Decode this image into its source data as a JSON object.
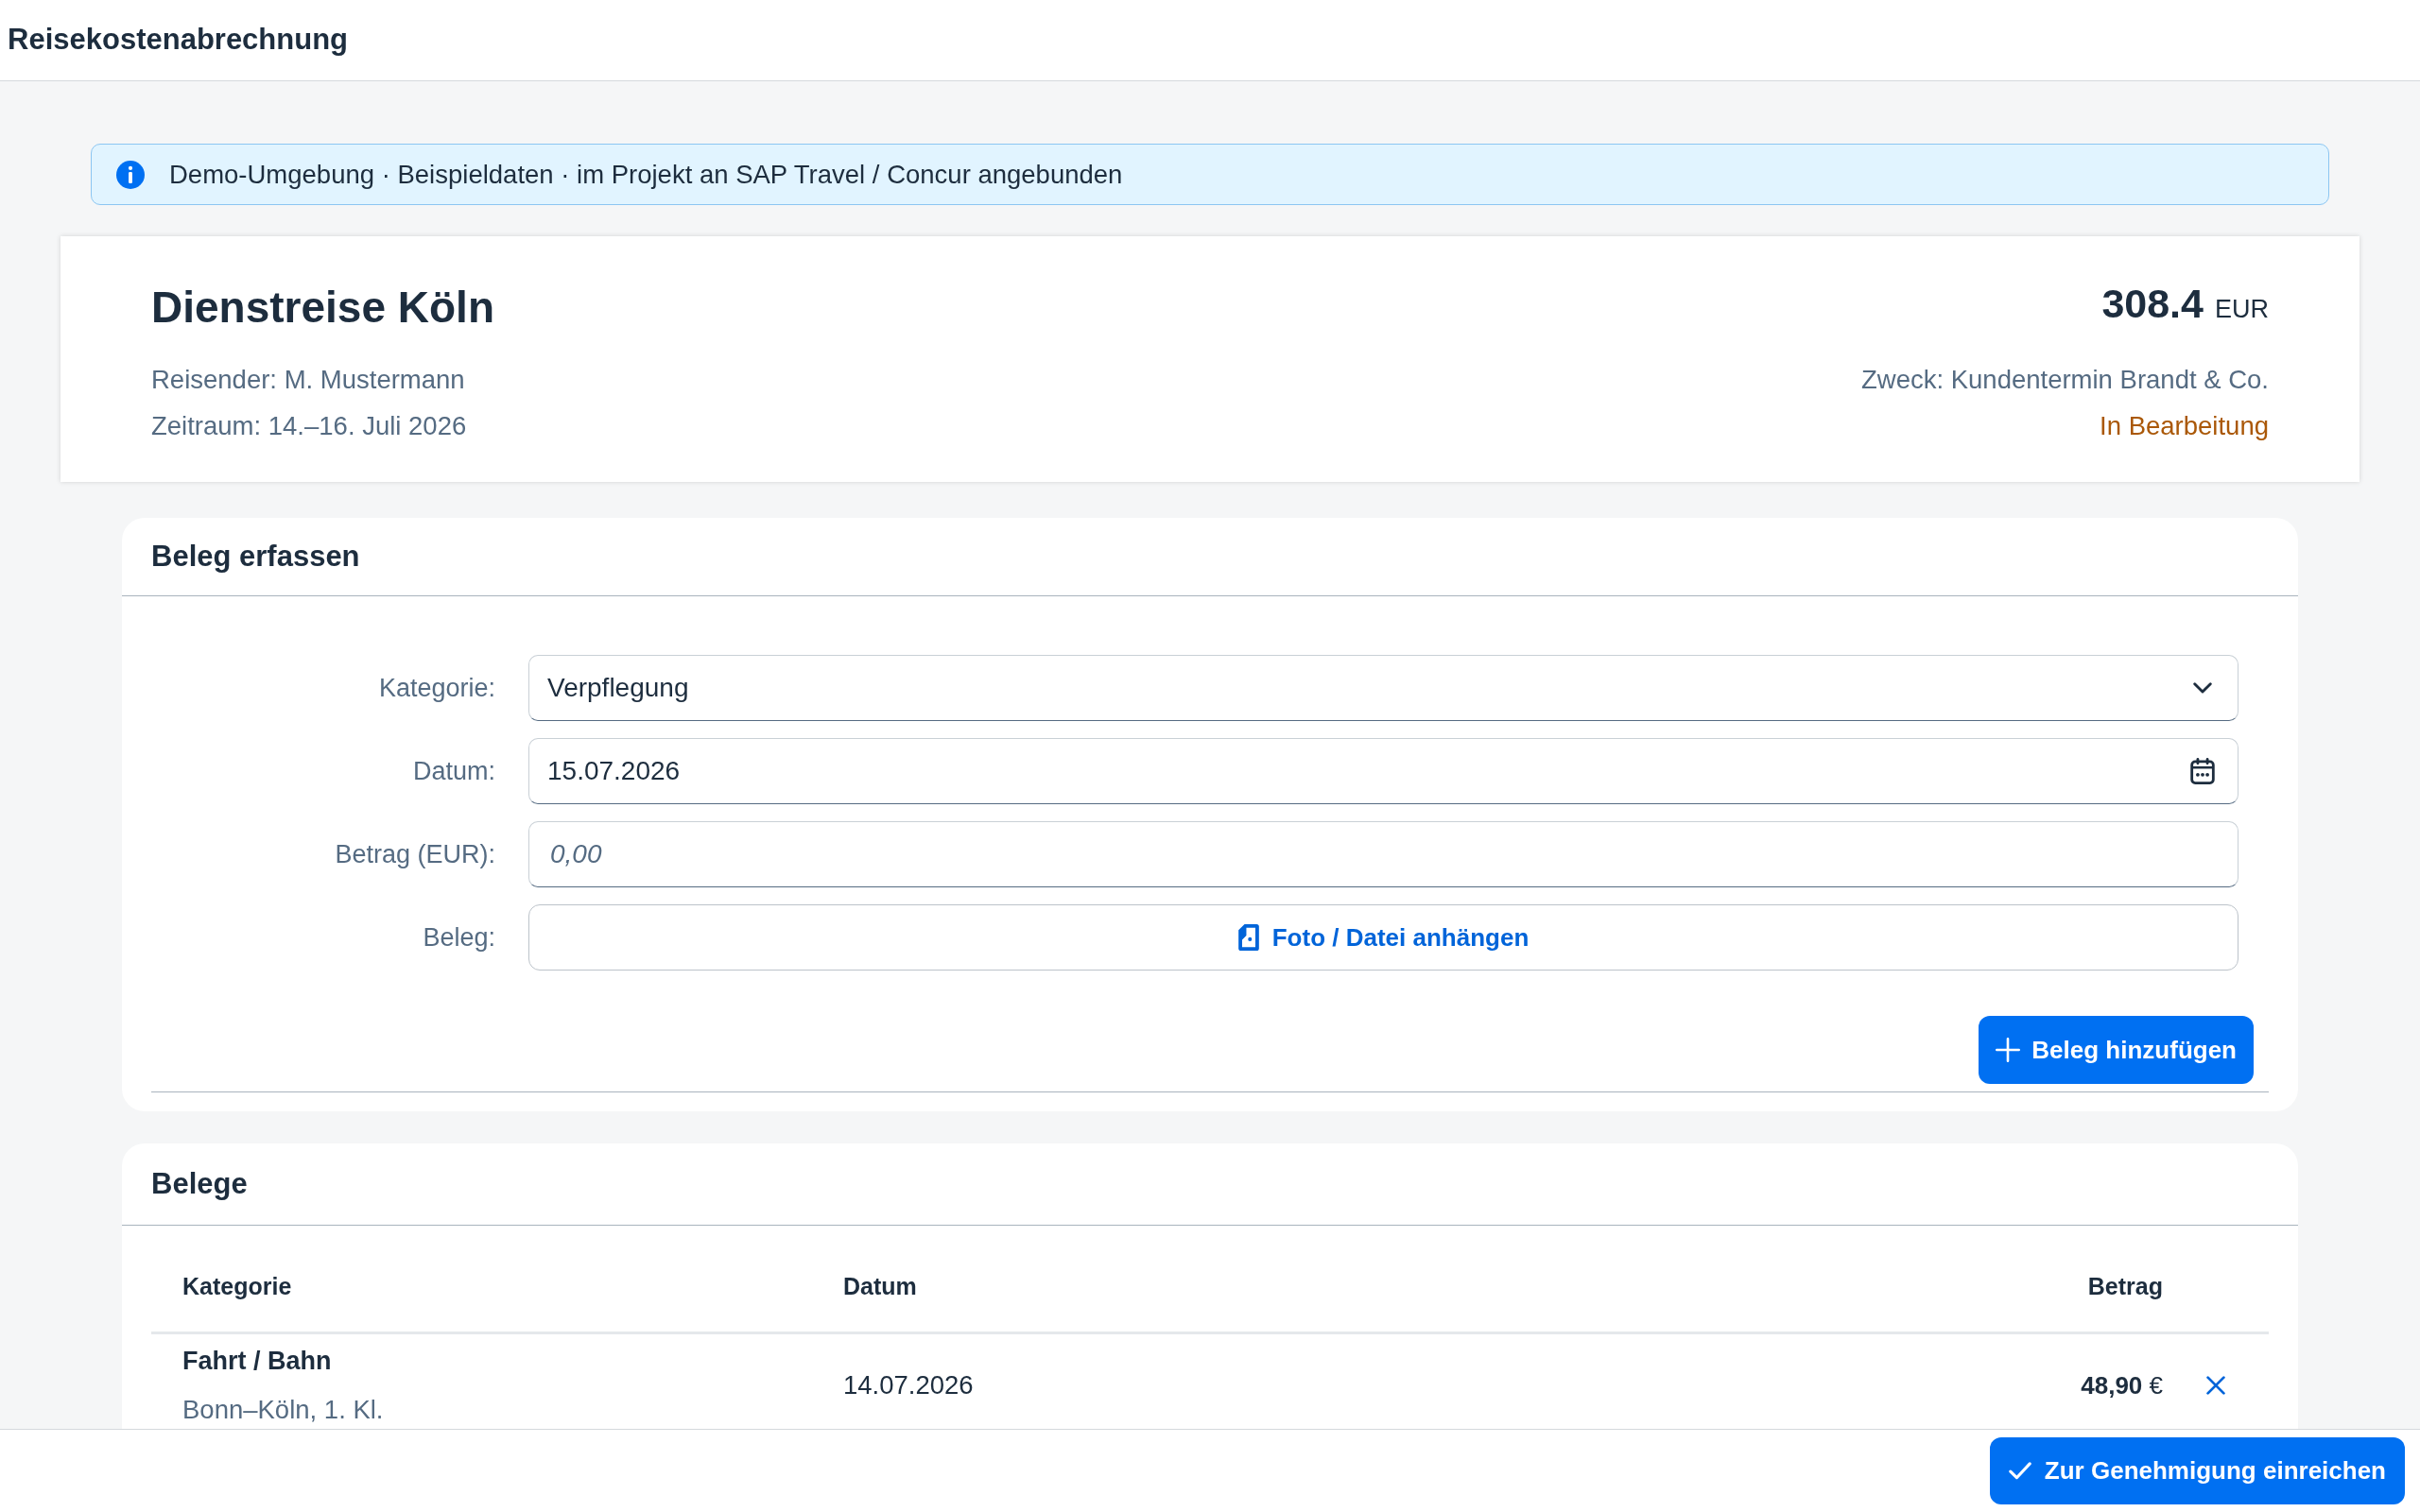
{
  "header": {
    "title": "Reisekostenabrechnung"
  },
  "info_banner": {
    "text": "Demo-Umgebung · Beispieldaten · im Projekt an SAP Travel / Concur angebunden"
  },
  "trip": {
    "title": "Dienstreise Köln",
    "traveler": "Reisender: M. Mustermann",
    "period": "Zeitraum: 14.–16. Juli 2026",
    "total": "308.4",
    "currency": "EUR",
    "purpose": "Zweck: Kundentermin Brandt & Co.",
    "status": {
      "label": "In Bearbeitung",
      "kind": "warning"
    }
  },
  "receipt_form": {
    "title": "Beleg erfassen",
    "fields": [
      {
        "kind": "select",
        "label": "Kategorie:",
        "value": "Verpflegung"
      },
      {
        "kind": "date",
        "label": "Datum:",
        "value": "15.07.2026"
      },
      {
        "kind": "text",
        "label": "Betrag (EUR):",
        "placeholder": "0,00"
      },
      {
        "kind": "upload",
        "label": "Beleg:",
        "button": "Foto / Datei anhängen"
      }
    ],
    "add_button": "Beleg hinzufügen"
  },
  "receipts": {
    "title": "Belege",
    "columns": [
      "Kategorie",
      "Datum",
      "Betrag"
    ],
    "rows": [
      {
        "category": "Fahrt / Bahn",
        "description": "Bonn–Köln, 1. Kl.",
        "date": "14.07.2026",
        "amount": "**48,90** €"
      }
    ]
  },
  "footer": {
    "submit_button": "Zur Genehmigung einreichen"
  }
}
